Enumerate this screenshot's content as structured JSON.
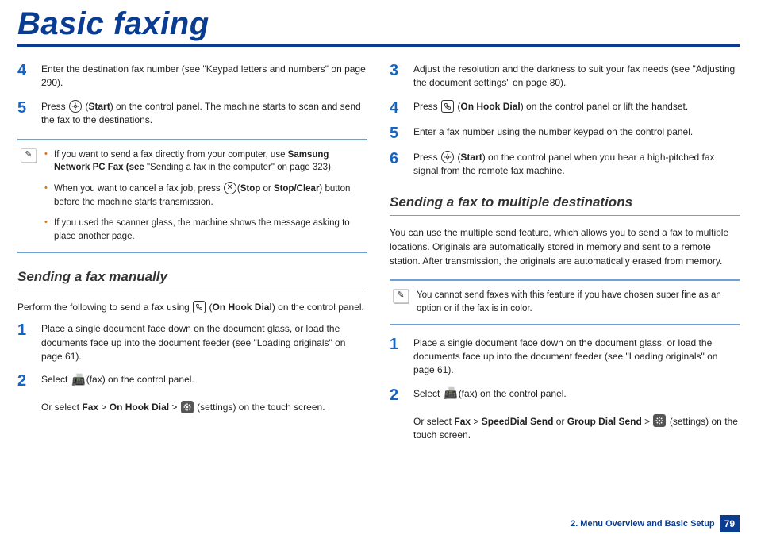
{
  "title": "Basic faxing",
  "left": {
    "step4": "Enter the destination fax number (see \"Keypad letters and numbers\" on page 290).",
    "step5_a": "Press ",
    "step5_b": "Start",
    "step5_c": ") on the control panel. The machine starts to scan and send the fax to the destinations.",
    "note1a": "If you want to send a fax directly from your computer, use ",
    "note1b": "Samsung Network PC Fax (see ",
    "note1c": "\"Sending a fax in the computer\" on page 323).",
    "note2a": "When you want to cancel a fax job, press ",
    "note2b": "Stop",
    "note2c": " or ",
    "note2d": "Stop/Clear",
    "note2e": ") button before the machine starts transmission.",
    "note3": "If you used the scanner glass, the machine shows the message asking to place another page.",
    "subhead": "Sending a fax manually",
    "intro_a": "Perform the following to send a fax using ",
    "intro_b": "On Hook Dial",
    "intro_c": ") on the control panel.",
    "m1": "Place a single document face down on the document glass, or load the documents face up into the document feeder (see \"Loading originals\" on page 61).",
    "m2a": "Select ",
    "m2b": "(fax) on the control panel.",
    "m2c": "Or select ",
    "m2d": "Fax",
    "m2e": "On Hook Dial",
    "m2f": "(settings) on the touch screen."
  },
  "right": {
    "r3": "Adjust the resolution and the darkness to suit your fax needs (see \"Adjusting the document settings\" on page 80).",
    "r4a": "Press ",
    "r4b": "On Hook Dial",
    "r4c": ") on the control panel or lift the handset.",
    "r5": "Enter a fax number using the number keypad on the control panel.",
    "r6a": "Press ",
    "r6b": "Start",
    "r6c": ") on the control panel when you hear a high-pitched fax signal from the remote fax machine.",
    "subhead": "Sending a fax to multiple destinations",
    "intro": "You can use the multiple send feature, which allows you to send a fax to multiple locations. Originals are automatically stored in memory and sent to a remote station. After transmission, the originals are automatically erased from memory.",
    "note": "You cannot send faxes with this feature if you have chosen super fine as an option or if the fax is in color.",
    "d1": "Place a single document face down on the document glass, or load the documents face up into the document feeder (see \"Loading originals\" on page 61).",
    "d2a": "Select ",
    "d2b": "(fax) on the control panel.",
    "d2c": "Or select ",
    "d2d": "Fax",
    "d2e": "SpeedDial Send",
    "d2f": " or ",
    "d2g": "Group Dial Send",
    "d2h": "(settings) on the touch screen."
  },
  "footer": {
    "chapter": "2. Menu Overview and Basic Setup",
    "page": "79"
  }
}
